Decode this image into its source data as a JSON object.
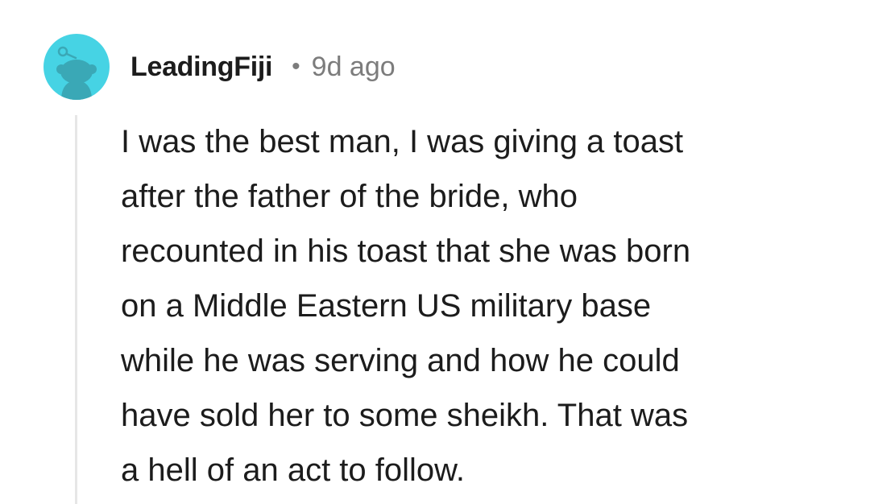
{
  "comment": {
    "username": "LeadingFiji",
    "separator": "•",
    "timestamp": "9d ago",
    "body": "I was the best man, I was giving a toast\nafter the father of the bride, who\nrecounted in his toast that she was born\non a Middle Eastern US military base\nwhile he was serving and how he could\nhave sold her to some sheikh. That was\na hell of an act to follow.",
    "avatar": {
      "icon": "snoo-avatar-icon",
      "background_color": "#46d3e4",
      "figure_color": "#3aa8b6"
    }
  }
}
